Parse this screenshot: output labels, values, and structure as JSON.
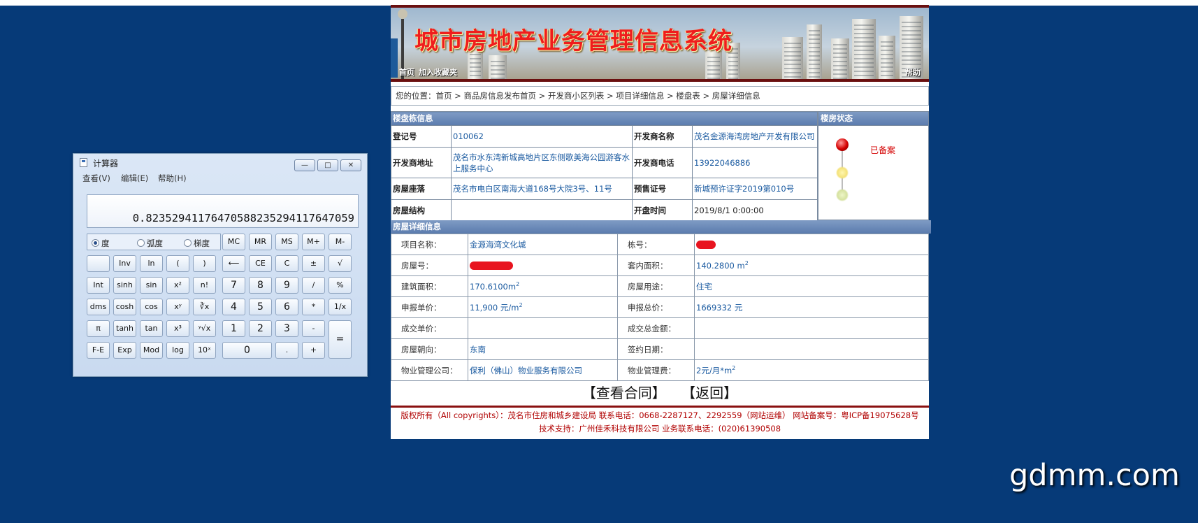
{
  "calculator": {
    "title": "计算器",
    "menu": [
      "查看(V)",
      "编辑(E)",
      "帮助(H)"
    ],
    "window_buttons": [
      "—",
      "□",
      "✕"
    ],
    "display": "0.8235294117647058823529411764705​9",
    "angle_modes": [
      "度",
      "弧度",
      "梯度"
    ],
    "memory_keys": [
      "MC",
      "MR",
      "MS",
      "M+",
      "M-"
    ],
    "rows": [
      [
        "",
        "Inv",
        "ln",
        "(",
        ")",
        "⟵",
        "CE",
        "C",
        "±",
        "√"
      ],
      [
        "Int",
        "sinh",
        "sin",
        "x²",
        "n!",
        "7",
        "8",
        "9",
        "/",
        "%"
      ],
      [
        "dms",
        "cosh",
        "cos",
        "xʸ",
        "∛x",
        "4",
        "5",
        "6",
        "*",
        "1/x"
      ],
      [
        "π",
        "tanh",
        "tan",
        "x³",
        "ʸ√x",
        "1",
        "2",
        "3",
        "-",
        "="
      ],
      [
        "F-E",
        "Exp",
        "Mod",
        "log",
        "10ˣ",
        "0",
        ".",
        "+"
      ]
    ]
  },
  "site": {
    "title": "城市房地产业务管理信息系统",
    "nav": {
      "home": "首页",
      "favorite": "加入收藏夹",
      "help": "帮助"
    },
    "breadcrumb": "您的位置：首页 > 商品房信息发布首页 > 开发商小区列表 > 项目详细信息 > 楼盘表 > 房屋详细信息",
    "building_section": "楼盘栋信息",
    "status_section": "楼房状态",
    "status_text": "已备案",
    "building": {
      "reg_no_label": "登记号",
      "reg_no": "010062",
      "dev_name_label": "开发商名称",
      "dev_name": "茂名金源海湾房地产开发有限公司",
      "dev_addr_label": "开发商地址",
      "dev_addr": "茂名市水东湾新城高地片区东侧歌美海公园游客水上服务中心",
      "dev_phone_label": "开发商电话",
      "dev_phone": "13922046886",
      "location_label": "房屋座落",
      "location": "茂名市电白区南海大道168号大院3号、11号",
      "permit_label": "预售证号",
      "permit": "新城预许证字2019第010号",
      "structure_label": "房屋结构",
      "structure": "",
      "open_time_label": "开盘时间",
      "open_time": "2019/8/1 0:00:00"
    },
    "detail_section": "房屋详细信息",
    "detail": {
      "project_label": "项目名称：",
      "project": "金源海湾文化城",
      "building_no_label": "栋号：",
      "room_label": "房屋号：",
      "inner_area_label": "套内面积：",
      "inner_area": "140.2800 m",
      "build_area_label": "建筑面积：",
      "build_area": "170.6100m",
      "usage_label": "房屋用途：",
      "usage": "住宅",
      "unit_price_label": "申报单价：",
      "unit_price": "11,900 元/m",
      "total_price_label": "申报总价：",
      "total_price": "1669332 元",
      "deal_unit_label": "成交单价：",
      "deal_total_label": "成交总金额：",
      "orientation_label": "房屋朝向：",
      "orientation": "东南",
      "sign_date_label": "签约日期：",
      "pm_company_label": "物业管理公司：",
      "pm_company": "保利（佛山）物业服务有限公司",
      "pm_fee_label": "物业管理费：",
      "pm_fee": "2元/月*m",
      "sup": "2"
    },
    "actions": {
      "contract": "【查看合同】",
      "back": "【返回】"
    },
    "footer": {
      "line1": "版权所有（All copyrights）：茂名市住房和城乡建设局 联系电话：0668-2287127、2292559（网站运维） 网站备案号：粤ICP备19075628号",
      "line2": "技术支持：广州佳禾科技有限公司     业务联系电话：(020)61390508"
    }
  },
  "watermark": "gdmm.com"
}
